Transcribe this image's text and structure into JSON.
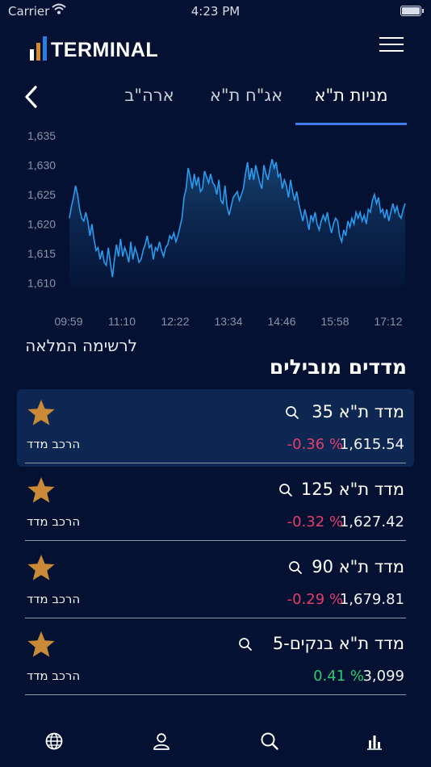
{
  "status_bar": {
    "carrier": "Carrier",
    "time": "4:23 PM"
  },
  "app": {
    "logo_text": "TERMINAL",
    "logo_colors": [
      "#ffffff",
      "#d48a2a",
      "#2b7fe0"
    ]
  },
  "tabs": [
    {
      "label": "מניות ת\"א",
      "active": true
    },
    {
      "label": "אג\"ח ת\"א",
      "active": false
    },
    {
      "label": "ארה\"ב",
      "active": false
    }
  ],
  "chart_data": {
    "type": "area",
    "y_ticks": [
      "1,635",
      "1,630",
      "1,625",
      "1,620",
      "1,615",
      "1,610"
    ],
    "ylim": [
      1609,
      1637
    ],
    "x_ticks": [
      "09:59",
      "11:10",
      "12:22",
      "13:34",
      "14:46",
      "15:58",
      "17:12"
    ],
    "values": [
      1621,
      1623,
      1624.5,
      1626.5,
      1625,
      1622.5,
      1621,
      1620.5,
      1622,
      1620.5,
      1618,
      1620,
      1617.5,
      1615.5,
      1616,
      1614,
      1615.5,
      1613.5,
      1613,
      1616,
      1613.5,
      1611,
      1614,
      1616.5,
      1614.5,
      1617.5,
      1614.5,
      1616,
      1615,
      1613.5,
      1617,
      1614,
      1616,
      1615,
      1613.5,
      1614,
      1615.5,
      1616.5,
      1618,
      1616,
      1616.5,
      1614,
      1616,
      1615.5,
      1617,
      1615.5,
      1614.5,
      1616,
      1616.5,
      1618,
      1617.5,
      1618.5,
      1617,
      1618,
      1619.5,
      1621,
      1624.5,
      1626,
      1629.5,
      1628,
      1626,
      1628.5,
      1626.5,
      1628,
      1625.5,
      1626,
      1629,
      1628,
      1627,
      1628.5,
      1627,
      1626.5,
      1625,
      1627.5,
      1624,
      1623.5,
      1626.5,
      1623,
      1621.5,
      1623,
      1624.5,
      1625,
      1625.5,
      1624,
      1625,
      1626,
      1628.5,
      1630.5,
      1627.5,
      1629.5,
      1627.5,
      1630,
      1628.5,
      1627,
      1626,
      1630,
      1628.5,
      1627.5,
      1629.5,
      1631,
      1629.5,
      1630.5,
      1628,
      1628.5,
      1626,
      1627.5,
      1626.5,
      1624.5,
      1627.5,
      1625.5,
      1624,
      1625.5,
      1623.5,
      1622,
      1620.5,
      1622.5,
      1621,
      1619,
      1621.5,
      1620.5,
      1622,
      1620,
      1619,
      1620.5,
      1621.5,
      1620.5,
      1622,
      1620,
      1618.5,
      1620,
      1621,
      1620.5,
      1618,
      1617,
      1619,
      1618,
      1620.5,
      1619.5,
      1621,
      1620,
      1622,
      1621,
      1622,
      1620.5,
      1621.5,
      1620,
      1622.5,
      1622,
      1624,
      1625,
      1623.5,
      1624.5,
      1622,
      1622.5,
      1621,
      1622.5,
      1620.5,
      1622,
      1623.5,
      1622,
      1623,
      1621.5,
      1621,
      1622.5,
      1623.5
    ]
  },
  "full_list_link": "לרשימה המלאה",
  "section_title": "מדדים מובילים",
  "indices": [
    {
      "name": "מדד ת\"א 35",
      "value": "1,615.54",
      "change": "-0.36 %",
      "direction": "down",
      "compose": "הרכב מדד",
      "highlighted": true
    },
    {
      "name": "מדד ת\"א 125",
      "value": "1,627.42",
      "change": "-0.32 %",
      "direction": "down",
      "compose": "הרכב מדד",
      "highlighted": false
    },
    {
      "name": "מדד ת\"א 90",
      "value": "1,679.81",
      "change": "-0.29 %",
      "direction": "down",
      "compose": "הרכב מדד",
      "highlighted": false
    },
    {
      "name": "מדד ת\"א בנקים-5",
      "value": "3,099",
      "change": "0.41 %",
      "direction": "up",
      "compose": "הרכב מדד",
      "highlighted": false
    }
  ],
  "bottom_nav": [
    {
      "icon": "globe-icon"
    },
    {
      "icon": "person-icon"
    },
    {
      "icon": "search-icon"
    },
    {
      "icon": "bar-chart-icon"
    }
  ],
  "colors": {
    "background": "#041132",
    "accent": "#3d7be8",
    "negative": "#e63d6a",
    "positive": "#2ecc71",
    "star": "#c98a38"
  }
}
